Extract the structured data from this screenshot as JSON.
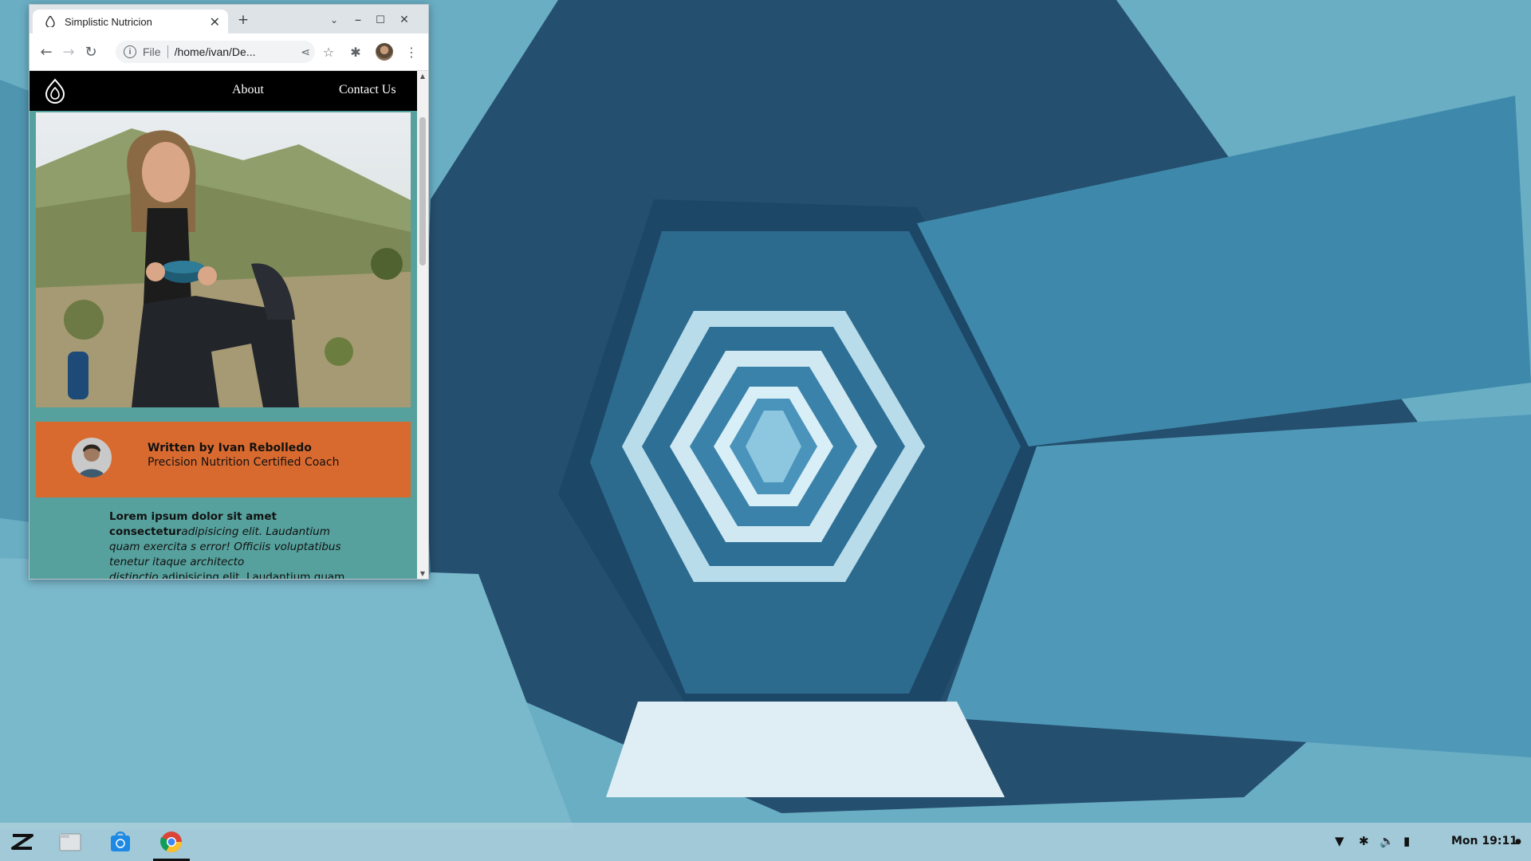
{
  "browser": {
    "tab_title": "Simplistic Nutricion",
    "new_tab_symbol": "+",
    "omnibox_scheme": "File",
    "omnibox_url": "/home/ivan/De..."
  },
  "site": {
    "nav_links": [
      "About",
      "Contact Us"
    ]
  },
  "author": {
    "name": "Written by Ivan Rebolledo",
    "title": "Precision Nutrition Certified Coach"
  },
  "article": {
    "bold_lead": "Lorem ipsum dolor sit amet consectetur",
    "italic_text": "adipisicing elit. Laudantium quam exercita s error! Officiis voluptatibus tenetur itaque architecto distinctio.",
    "trailing_text": "adipisicing elit. Laudantium quam"
  },
  "taskbar": {
    "clock": "Mon 19:11"
  },
  "colors": {
    "page_bg": "#56a19d",
    "author_card": "#d96a2f",
    "nav_bg": "#000000"
  }
}
